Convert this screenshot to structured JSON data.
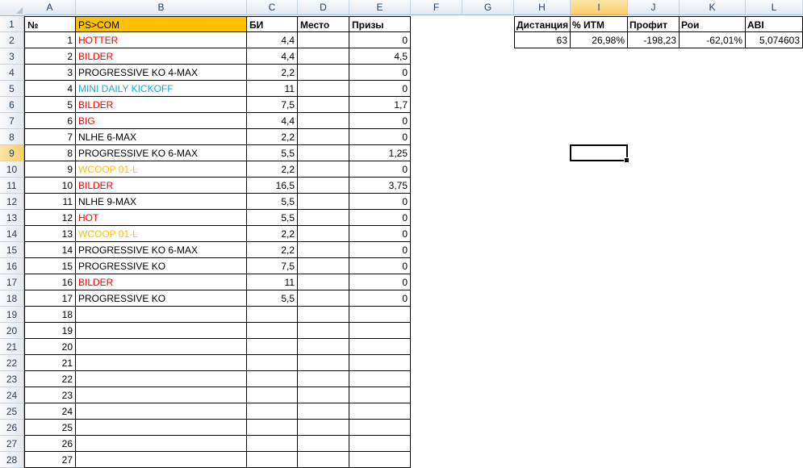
{
  "columns": [
    "A",
    "B",
    "C",
    "D",
    "E",
    "F",
    "G",
    "H",
    "I",
    "J",
    "K",
    "L"
  ],
  "selected_column": "I",
  "selected_row": "9",
  "row_numbers": [
    "1",
    "2",
    "3",
    "4",
    "5",
    "6",
    "7",
    "8",
    "9",
    "10",
    "11",
    "12",
    "13",
    "14",
    "15",
    "16",
    "17",
    "18",
    "19",
    "20",
    "21",
    "22",
    "23",
    "24",
    "25",
    "26",
    "27",
    "28"
  ],
  "colors": {
    "red": "#ff0000",
    "blue": "#1ea5d6",
    "gold": "#ffc000",
    "header_fill": "#ffc000"
  },
  "table_headers": {
    "num": "№",
    "name": "PS>COM",
    "bi": "БИ",
    "place": "Место",
    "prizes": "Призы"
  },
  "rows": [
    {
      "n": "1",
      "name": "HOTTER",
      "color": "red",
      "bi": "4,4",
      "prize": "0"
    },
    {
      "n": "2",
      "name": "BILDER",
      "color": "red",
      "bi": "4,4",
      "prize": "4,5"
    },
    {
      "n": "3",
      "name": "PROGRESSIVE KO 4-MAX",
      "color": "black",
      "bi": "2,2",
      "prize": "0"
    },
    {
      "n": "4",
      "name": "MINI DAILY KICKOFF",
      "color": "blue",
      "bi": "11",
      "prize": "0"
    },
    {
      "n": "5",
      "name": "BILDER",
      "color": "red",
      "bi": "7,5",
      "prize": "1,7"
    },
    {
      "n": "6",
      "name": "BIG",
      "color": "red",
      "bi": "4,4",
      "prize": "0"
    },
    {
      "n": "7",
      "name": "NLHE 6-MAX",
      "color": "black",
      "bi": "2,2",
      "prize": "0"
    },
    {
      "n": "8",
      "name": "PROGRESSIVE KO 6-MAX",
      "color": "black",
      "bi": "5,5",
      "prize": "1,25"
    },
    {
      "n": "9",
      "name": "WCOOP 01-L",
      "color": "gold",
      "bi": "2,2",
      "prize": "0"
    },
    {
      "n": "10",
      "name": "BILDER",
      "color": "red",
      "bi": "16,5",
      "prize": "3,75"
    },
    {
      "n": "11",
      "name": "NLHE 9-MAX",
      "color": "black",
      "bi": "5,5",
      "prize": "0"
    },
    {
      "n": "12",
      "name": "HOT",
      "color": "red",
      "bi": "5,5",
      "prize": "0"
    },
    {
      "n": "13",
      "name": "WCOOP 01-L",
      "color": "gold",
      "bi": "2,2",
      "prize": "0"
    },
    {
      "n": "14",
      "name": "PROGRESSIVE KO 6-MAX",
      "color": "black",
      "bi": "2,2",
      "prize": "0"
    },
    {
      "n": "15",
      "name": "PROGRESSIVE KO",
      "color": "black",
      "bi": "7,5",
      "prize": "0"
    },
    {
      "n": "16",
      "name": "BILDER",
      "color": "red",
      "bi": "11",
      "prize": "0"
    },
    {
      "n": "17",
      "name": "PROGRESSIVE KO",
      "color": "black",
      "bi": "5,5",
      "prize": "0"
    },
    {
      "n": "18",
      "name": "",
      "color": "black",
      "bi": "",
      "prize": ""
    },
    {
      "n": "19",
      "name": "",
      "color": "black",
      "bi": "",
      "prize": ""
    },
    {
      "n": "20",
      "name": "",
      "color": "black",
      "bi": "",
      "prize": ""
    },
    {
      "n": "21",
      "name": "",
      "color": "black",
      "bi": "",
      "prize": ""
    },
    {
      "n": "22",
      "name": "",
      "color": "black",
      "bi": "",
      "prize": ""
    },
    {
      "n": "23",
      "name": "",
      "color": "black",
      "bi": "",
      "prize": ""
    },
    {
      "n": "24",
      "name": "",
      "color": "black",
      "bi": "",
      "prize": ""
    },
    {
      "n": "25",
      "name": "",
      "color": "black",
      "bi": "",
      "prize": ""
    },
    {
      "n": "26",
      "name": "",
      "color": "black",
      "bi": "",
      "prize": ""
    },
    {
      "n": "27",
      "name": "",
      "color": "black",
      "bi": "",
      "prize": ""
    }
  ],
  "stats": {
    "headers": {
      "distance": "Дистанция",
      "itm": "% ИТМ",
      "profit": "Профит",
      "roi": "Рои",
      "abi": "ABI"
    },
    "values": {
      "distance": "63",
      "itm": "26,98%",
      "profit": "-198,23",
      "roi": "-62,01%",
      "abi": "5,074603"
    }
  }
}
